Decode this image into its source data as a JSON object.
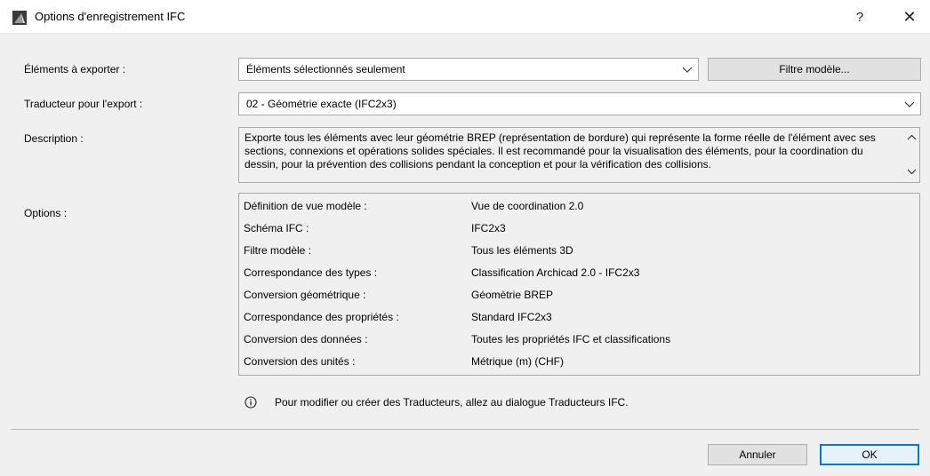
{
  "window": {
    "title": "Options d'enregistrement IFC",
    "help_glyph": "?",
    "close_glyph": "✕"
  },
  "form": {
    "elements_label": "Éléments à exporter :",
    "elements_value": "Éléments sélectionnés seulement",
    "filter_button": "Filtre modèle...",
    "translator_label": "Traducteur pour l'export :",
    "translator_value": "02 - Géométrie exacte (IFC2x3)",
    "description_label": "Description :",
    "description_text": "Exporte tous les éléments avec leur géométrie BREP (représentation de bordure) qui représente la forme réelle de l'élément avec ses sections, connexions et opérations solides spéciales. Il est recommandé pour la visualisation des éléments, pour la coordination du dessin, pour la prévention des collisions pendant la conception et pour la vérification des collisions.",
    "options_label": "Options :"
  },
  "options": [
    {
      "key": "Définition de vue modèle :",
      "value": "Vue de coordination 2.0"
    },
    {
      "key": "Schéma IFC :",
      "value": "IFC2x3"
    },
    {
      "key": "Filtre modèle :",
      "value": "Tous les éléments 3D"
    },
    {
      "key": "Correspondance des types :",
      "value": "Classification Archicad 2.0 - IFC2x3"
    },
    {
      "key": "Conversion géométrique :",
      "value": "Géomètrie BREP"
    },
    {
      "key": "Correspondance des propriétés :",
      "value": "Standard IFC2x3"
    },
    {
      "key": "Conversion des données :",
      "value": "Toutes les propriétés IFC et classifications"
    },
    {
      "key": "Conversion des unités :",
      "value": "Métrique (m) (CHF)"
    }
  ],
  "info": {
    "icon": "info-icon",
    "text": "Pour modifier ou créer des Traducteurs, allez au dialogue Traducteurs IFC."
  },
  "footer": {
    "cancel_label": "Annuler",
    "ok_label": "OK"
  },
  "colors": {
    "dialog_bg": "#f0f0f0",
    "accent": "#0078d7"
  }
}
